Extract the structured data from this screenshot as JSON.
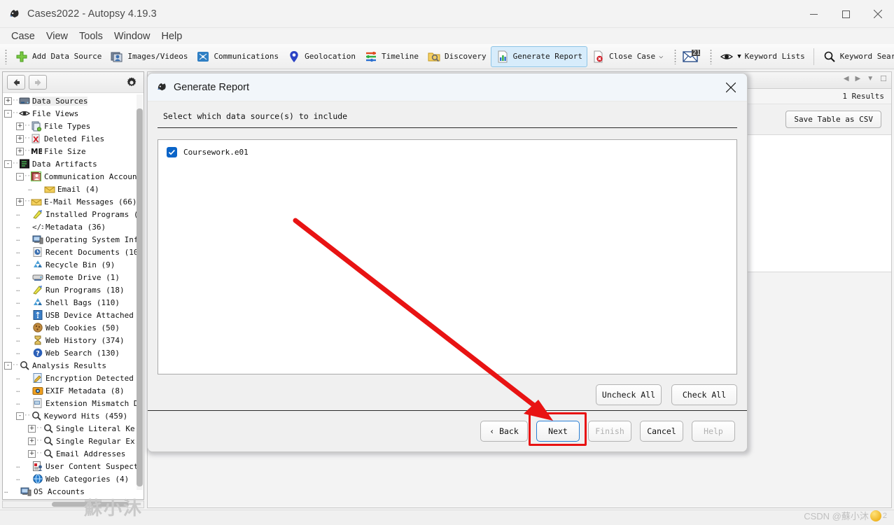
{
  "window": {
    "title": "Cases2022 - Autopsy 4.19.3",
    "app_icon": "autopsy-icon",
    "controls": {
      "minimize": "—",
      "maximize": "□",
      "close": "✕"
    }
  },
  "menubar": {
    "items": [
      "Case",
      "View",
      "Tools",
      "Window",
      "Help"
    ]
  },
  "toolbar": {
    "items": [
      {
        "label": "Add Data Source",
        "icon": "plus-green-icon",
        "active": false
      },
      {
        "label": "Images/Videos",
        "icon": "images-videos-icon",
        "active": false
      },
      {
        "label": "Communications",
        "icon": "communications-icon",
        "active": false
      },
      {
        "label": "Geolocation",
        "icon": "map-pin-icon",
        "active": false
      },
      {
        "label": "Timeline",
        "icon": "timeline-icon",
        "active": false
      },
      {
        "label": "Discovery",
        "icon": "discovery-icon",
        "active": false
      },
      {
        "label": "Generate Report",
        "icon": "report-chart-icon",
        "active": true
      },
      {
        "label": "Close Case",
        "icon": "close-case-icon",
        "active": false,
        "has_chevron": true
      }
    ],
    "mail_badge": "21",
    "mail_icon": "envelope-icon",
    "keyword_lists": {
      "label": "Keyword Lists",
      "icon": "eye-icon"
    },
    "keyword_search": {
      "label": "Keyword Search",
      "icon": "magnifier-icon"
    }
  },
  "tree": {
    "nav": {
      "back": "back-arrow",
      "forward": "forward-arrow",
      "settings": "gear-icon"
    },
    "nodes": [
      {
        "label": "Data Sources",
        "indent": 0,
        "exp": "+",
        "icon": "datasource-icon",
        "selected": true
      },
      {
        "label": "File Views",
        "indent": 0,
        "exp": "-",
        "icon": "eye-icon",
        "selected": false
      },
      {
        "label": "File Types",
        "indent": 1,
        "exp": "+",
        "icon": "filetypes-icon",
        "selected": false
      },
      {
        "label": "Deleted Files",
        "indent": 1,
        "exp": "+",
        "icon": "deleted-icon",
        "selected": false
      },
      {
        "label": "File Size",
        "indent": 1,
        "exp": "+",
        "icon": "mb-icon",
        "selected": false
      },
      {
        "label": "Data Artifacts",
        "indent": 0,
        "exp": "-",
        "icon": "artifacts-icon",
        "selected": false
      },
      {
        "label": "Communication Accoun",
        "indent": 1,
        "exp": "-",
        "icon": "contacts-icon",
        "selected": false
      },
      {
        "label": "Email  (4)",
        "indent": 2,
        "exp": "",
        "icon": "mail-yellow-icon",
        "selected": false
      },
      {
        "label": "E-Mail Messages  (66)",
        "indent": 1,
        "exp": "+",
        "icon": "mail-yellow-icon",
        "selected": false
      },
      {
        "label": "Installed Programs  (",
        "indent": 1,
        "exp": "",
        "icon": "installed-icon",
        "selected": false
      },
      {
        "label": "Metadata  (36)",
        "indent": 1,
        "exp": "",
        "icon": "code-icon",
        "selected": false
      },
      {
        "label": "Operating System Inf",
        "indent": 1,
        "exp": "",
        "icon": "os-icon",
        "selected": false
      },
      {
        "label": "Recent Documents  (10",
        "indent": 1,
        "exp": "",
        "icon": "recentdoc-icon",
        "selected": false
      },
      {
        "label": "Recycle Bin  (9)",
        "indent": 1,
        "exp": "",
        "icon": "recycle-icon",
        "selected": false
      },
      {
        "label": "Remote Drive  (1)",
        "indent": 1,
        "exp": "",
        "icon": "drive-icon",
        "selected": false
      },
      {
        "label": "Run Programs  (18)",
        "indent": 1,
        "exp": "",
        "icon": "installed-icon",
        "selected": false
      },
      {
        "label": "Shell Bags  (110)",
        "indent": 1,
        "exp": "",
        "icon": "recycle-icon",
        "selected": false
      },
      {
        "label": "USB Device Attached",
        "indent": 1,
        "exp": "",
        "icon": "usb-icon",
        "selected": false
      },
      {
        "label": "Web Cookies  (50)",
        "indent": 1,
        "exp": "",
        "icon": "cookie-icon",
        "selected": false
      },
      {
        "label": "Web History  (374)",
        "indent": 1,
        "exp": "",
        "icon": "hourglass-icon",
        "selected": false
      },
      {
        "label": "Web Search  (130)",
        "indent": 1,
        "exp": "",
        "icon": "websearch-icon",
        "selected": false
      },
      {
        "label": "Analysis Results",
        "indent": 0,
        "exp": "-",
        "icon": "magnifier-icon",
        "selected": false
      },
      {
        "label": "Encryption Detected",
        "indent": 1,
        "exp": "",
        "icon": "encryption-icon",
        "selected": false
      },
      {
        "label": "EXIF Metadata  (8)",
        "indent": 1,
        "exp": "",
        "icon": "camera-icon",
        "selected": false
      },
      {
        "label": "Extension Mismatch D",
        "indent": 1,
        "exp": "",
        "icon": "mismatch-icon",
        "selected": false
      },
      {
        "label": "Keyword Hits  (459)",
        "indent": 1,
        "exp": "-",
        "icon": "magnifier-icon",
        "selected": false
      },
      {
        "label": "Single Literal Ke",
        "indent": 2,
        "exp": "+",
        "icon": "magnifier-icon",
        "selected": false
      },
      {
        "label": "Single Regular Ex",
        "indent": 2,
        "exp": "+",
        "icon": "magnifier-icon",
        "selected": false
      },
      {
        "label": "Email Addresses  ",
        "indent": 2,
        "exp": "+",
        "icon": "magnifier-icon",
        "selected": false
      },
      {
        "label": "User Content Suspect",
        "indent": 1,
        "exp": "",
        "icon": "usercontent-icon",
        "selected": false
      },
      {
        "label": "Web Categories  (4)",
        "indent": 1,
        "exp": "",
        "icon": "globe-icon",
        "selected": false
      },
      {
        "label": "OS Accounts",
        "indent": 0,
        "exp": "",
        "icon": "os-icon",
        "selected": false
      }
    ]
  },
  "right_panel": {
    "results_count": "1 Results",
    "save_csv_label": "Save Table as CSV",
    "tab_controls": [
      "prev-arrow-icon",
      "next-arrow-icon",
      "dropdown-icon",
      "maximize-icon"
    ]
  },
  "dialog": {
    "title": "Generate Report",
    "icon": "autopsy-icon",
    "close_icon": "close-icon",
    "instruction": "Select which data source(s) to include",
    "data_sources": [
      {
        "label": "Coursework.e01",
        "checked": true
      }
    ],
    "list_buttons": [
      {
        "label": "Uncheck All",
        "disabled": false
      },
      {
        "label": "Check All",
        "disabled": false
      }
    ],
    "footer_buttons": [
      {
        "label": "‹ Back",
        "disabled": false,
        "primary": false,
        "highlighted": false
      },
      {
        "label": "Next",
        "disabled": false,
        "primary": true,
        "highlighted": true
      },
      {
        "label": "Finish",
        "disabled": true,
        "primary": false,
        "highlighted": false
      },
      {
        "label": "Cancel",
        "disabled": false,
        "primary": false,
        "highlighted": false
      },
      {
        "label": "Help",
        "disabled": true,
        "primary": false,
        "highlighted": false
      }
    ]
  },
  "annotations": {
    "arrow_color": "#e81313",
    "highlight_color": "#e81313"
  },
  "watermarks": {
    "left": "蘇小沐",
    "right": "CSDN @蘇小沐",
    "right_badge_count": "2"
  }
}
